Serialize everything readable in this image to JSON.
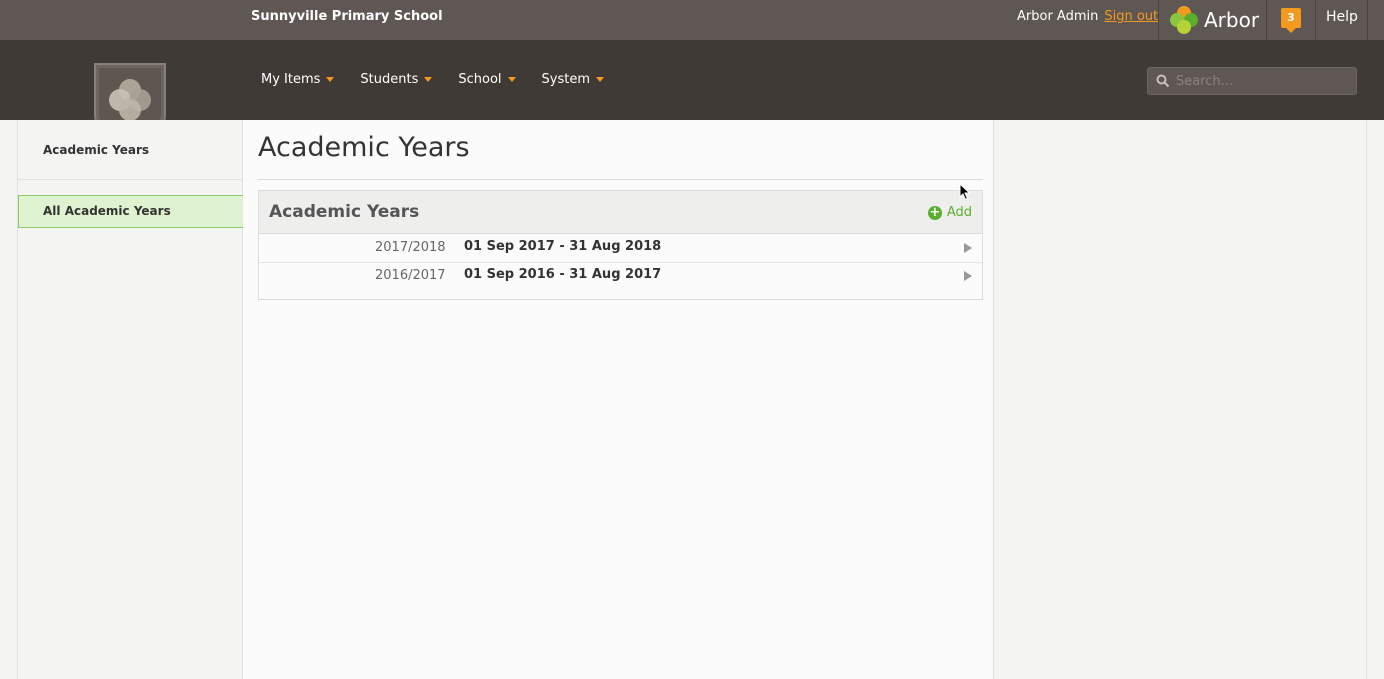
{
  "topbar": {
    "school_name": "Sunnyville Primary School",
    "user_name": "Arbor Admin",
    "sign_out_label": "Sign out",
    "brand_name": "Arbor",
    "notification_count": "3",
    "help_label": "Help"
  },
  "nav": {
    "items": [
      {
        "label": "My Items",
        "icon": "caret-down-icon"
      },
      {
        "label": "Students",
        "icon": "caret-down-icon"
      },
      {
        "label": "School",
        "icon": "caret-down-icon"
      },
      {
        "label": "System",
        "icon": "caret-down-icon"
      }
    ],
    "search_placeholder": "Search..."
  },
  "sidebar": {
    "title": "Academic Years",
    "items": [
      {
        "label": "All Academic Years",
        "active": true
      }
    ]
  },
  "main": {
    "page_title": "Academic Years",
    "panel": {
      "title": "Academic Years",
      "add_label": "Add",
      "rows": [
        {
          "year": "2017/2018",
          "dates": "01 Sep 2017 - 31 Aug 2018"
        },
        {
          "year": "2016/2017",
          "dates": "01 Sep 2016 - 31 Aug 2017"
        }
      ]
    }
  },
  "colors": {
    "topbar_bg": "#5f5753",
    "navbar_bg": "#403a36",
    "accent_orange": "#f39a1e",
    "accent_green": "#5aae2e",
    "active_item_bg": "#dff3d1"
  }
}
